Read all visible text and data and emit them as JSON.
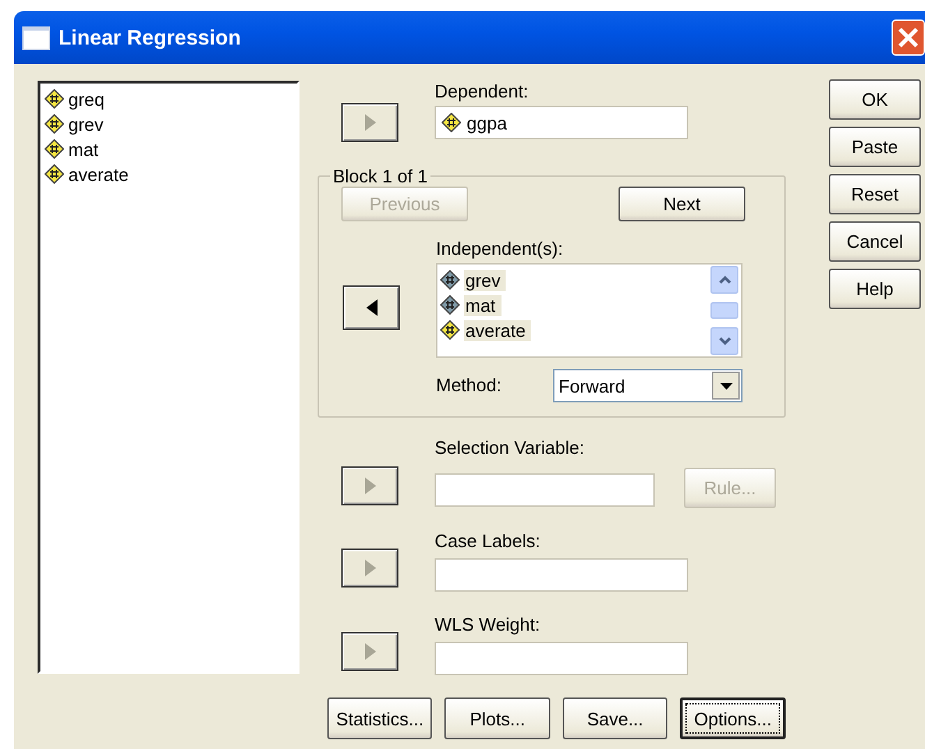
{
  "window": {
    "title": "Linear Regression"
  },
  "variables": [
    {
      "name": "greq",
      "kind": "scale"
    },
    {
      "name": "grev",
      "kind": "scale"
    },
    {
      "name": "mat",
      "kind": "scale"
    },
    {
      "name": "averate",
      "kind": "scale"
    }
  ],
  "dependent": {
    "label": "Dependent:",
    "arrow": {
      "kind": "right",
      "disabled": true
    },
    "value": {
      "name": "ggpa",
      "kind": "scale"
    }
  },
  "block": {
    "title": "Block 1 of 1",
    "previous": {
      "label": "Previous",
      "disabled": true
    },
    "next": {
      "label": "Next",
      "disabled": false
    },
    "independents_label": "Independent(s):",
    "arrow": {
      "kind": "left",
      "disabled": false
    },
    "independents": [
      {
        "name": "grev",
        "kind": "ordinal",
        "selected": true
      },
      {
        "name": "mat",
        "kind": "ordinal",
        "selected": true
      },
      {
        "name": "averate",
        "kind": "scale",
        "selected": true
      }
    ],
    "method_label": "Method:",
    "method": "Forward"
  },
  "selection": {
    "label": "Selection Variable:",
    "arrow": {
      "kind": "right",
      "disabled": true
    },
    "rule": {
      "label": "Rule...",
      "disabled": true
    }
  },
  "case_labels": {
    "label": "Case Labels:",
    "arrow": {
      "kind": "right",
      "disabled": true
    }
  },
  "wls": {
    "label": "WLS Weight:",
    "arrow": {
      "kind": "right",
      "disabled": true
    }
  },
  "bottom_buttons": [
    {
      "label": "Statistics...",
      "focused": false
    },
    {
      "label": "Plots...",
      "focused": false
    },
    {
      "label": "Save...",
      "focused": false
    },
    {
      "label": "Options...",
      "focused": true
    }
  ],
  "side_buttons": [
    {
      "label": "OK"
    },
    {
      "label": "Paste"
    },
    {
      "label": "Reset"
    },
    {
      "label": "Cancel"
    },
    {
      "label": "Help"
    }
  ]
}
